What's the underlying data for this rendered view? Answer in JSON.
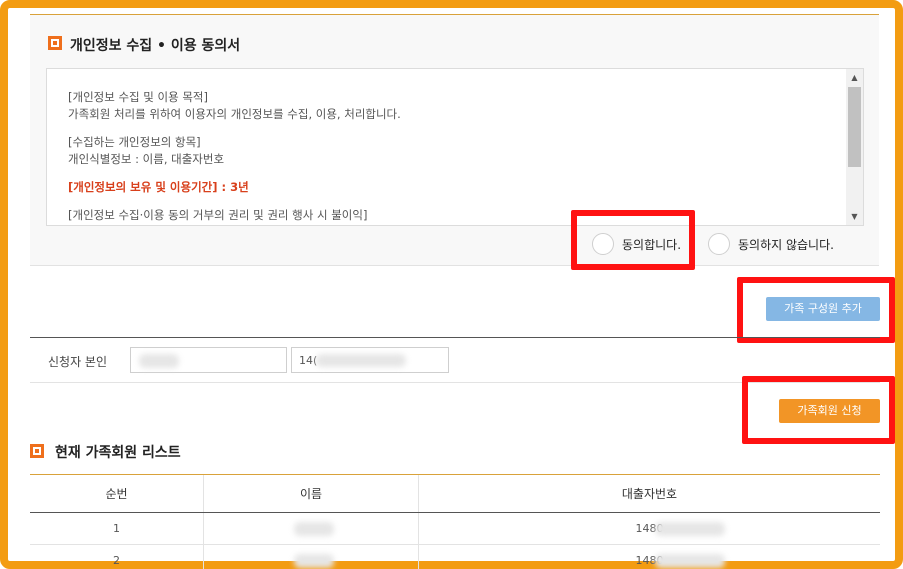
{
  "consent": {
    "title": "개인정보 수집 • 이용 동의서",
    "paragraphs": [
      [
        "[개인정보 수집 및 이용 목적]",
        "가족회원 처리를 위하여 이용자의 개인정보를 수집, 이용, 처리합니다."
      ],
      [
        "[수집하는 개인정보의 항목]",
        "개인식별정보 : 이름, 대출자번호"
      ]
    ],
    "retention": "[개인정보의 보유 및 이용기간] : 3년",
    "cutoff_line": "[개인정보 수집·이용 동의 거부의 권리 및 권리 행사 시 불이익]",
    "agree_label": "동의합니다.",
    "disagree_label": "동의하지 않습니다."
  },
  "buttons": {
    "add_family": "가족 구성원 추가",
    "apply": "가족회원 신청"
  },
  "applicant": {
    "label": "신청자 본인",
    "id_prefix": "14("
  },
  "family_list": {
    "title": "현재 가족회원 리스트",
    "columns": [
      "순번",
      "이름",
      "대출자번호"
    ],
    "rows": [
      {
        "no": "1",
        "loan_no": "1480"
      },
      {
        "no": "2",
        "loan_no": "1480"
      }
    ]
  },
  "colors": {
    "frame": "#f39c12",
    "highlight_box": "#ff1212",
    "accent_orange": "#ef6f1c",
    "apply_button": "#f29526",
    "add_button": "#85b7e4"
  }
}
